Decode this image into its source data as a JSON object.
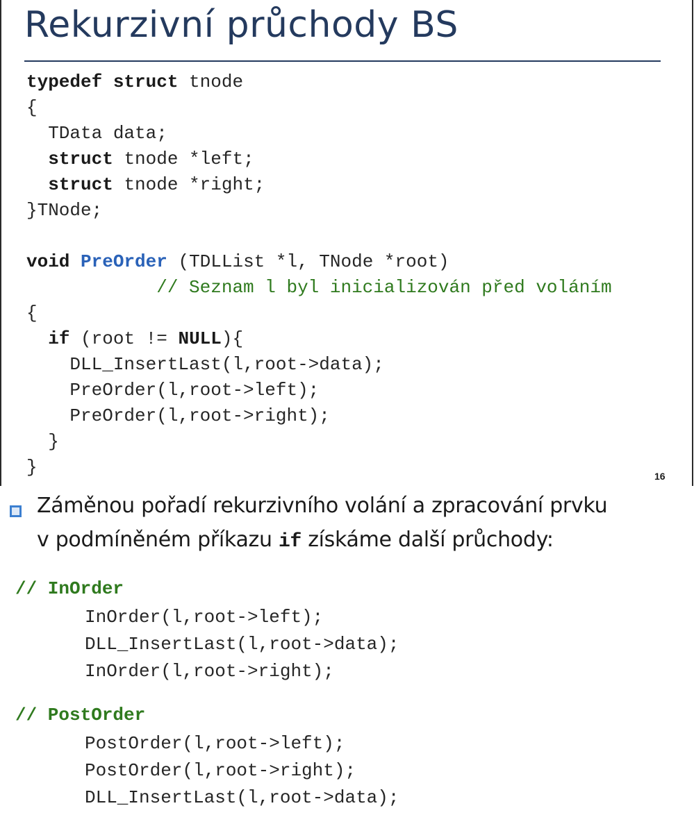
{
  "slide_top": {
    "title": "Rekurzivní průchody BS",
    "page_number": "16",
    "code": {
      "l1_kw1": "typedef",
      "l1_kw2": "struct",
      "l1_rest": " tnode",
      "l2": "{",
      "l3": "  TData data;",
      "l4_kw": "struct",
      "l4_rest": " tnode *left;",
      "l5_kw": "struct",
      "l5_rest": " tnode *right;",
      "l6": "}TNode;",
      "l8_kw": "void",
      "l8_fn": "PreOrder",
      "l8_rest": " (TDLList *l, TNode *root)",
      "l9_comment": "// Seznam l byl inicializován před voláním",
      "l10": "{",
      "l11_kw": "if",
      "l11_mid": " (root != ",
      "l11_null": "NULL",
      "l11_end": "){",
      "l12": "    DLL_InsertLast(l,root->data);",
      "l13": "    PreOrder(l,root->left);",
      "l14": "    PreOrder(l,root->right);",
      "l15": "  }",
      "l16": "}"
    }
  },
  "slide_bottom": {
    "bullet": {
      "line1": "Záměnou pořadí rekurzivního volání a zpracování prvku",
      "line2_start": "v podmíněném příkazu ",
      "line2_kw": "if",
      "line2_end": " získáme další průchody:"
    },
    "inorder": {
      "heading": "// InOrder",
      "lines": [
        "InOrder(l,root->left);",
        "DLL_InsertLast(l,root->data);",
        "InOrder(l,root->right);"
      ]
    },
    "postorder": {
      "heading": "// PostOrder",
      "lines": [
        "PostOrder(l,root->left);",
        "PostOrder(l,root->right);",
        "DLL_InsertLast(l,root->data);"
      ]
    }
  },
  "colors": {
    "title": "#243a5e",
    "keyword_function": "#2a62b8",
    "comment": "#2f7a1e",
    "bullet": "#3b7fd0"
  }
}
